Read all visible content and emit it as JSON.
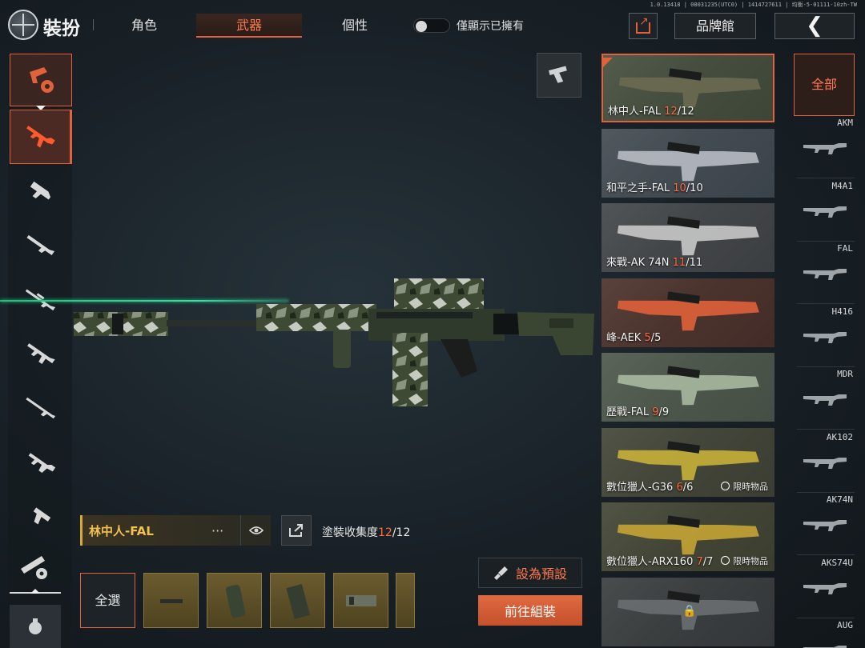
{
  "version_text": "1.0.13418 | 08031235(UTC0) | 1414727611 | 均衡-5-01111-10zh-TW",
  "header": {
    "title": "裝扮",
    "tabs": [
      {
        "label": "角色",
        "active": false
      },
      {
        "label": "武器",
        "active": true
      },
      {
        "label": "個性",
        "active": false
      }
    ],
    "owned_only_label": "僅顯示已擁有",
    "owned_only_on": false,
    "brand_button": "品牌館"
  },
  "left_categories": [
    {
      "icon": "skin-category-icon",
      "selected": false
    },
    {
      "icon": "assault-rifle-icon",
      "selected": true
    },
    {
      "icon": "smg-icon",
      "selected": false
    },
    {
      "icon": "shotgun-icon",
      "selected": false
    },
    {
      "icon": "sniper-rifle-icon",
      "selected": false
    },
    {
      "icon": "lmg-icon",
      "selected": false
    },
    {
      "icon": "marksman-rifle-icon",
      "selected": false
    },
    {
      "icon": "carbine-icon",
      "selected": false
    },
    {
      "icon": "pistol-icon",
      "selected": false
    },
    {
      "icon": "accessory-category-icon",
      "selected": false
    }
  ],
  "current_skin": {
    "name": "林中人-FAL",
    "more": "···",
    "collection_label": "塗裝收集度",
    "collected": "12",
    "total": "/12"
  },
  "parts_panel": {
    "select_all": "全選",
    "parts": [
      "muzzle-part",
      "grip-part",
      "magazine-part",
      "scope-part"
    ]
  },
  "actions": {
    "set_default": "設為預設",
    "go_assemble": "前往組裝"
  },
  "skins": [
    {
      "name": "林中人-FAL ",
      "owned": "12",
      "total": "/12",
      "limited": "",
      "locked": false,
      "selected": true,
      "colors": [
        "#4e5a3e",
        "#6c6a52"
      ]
    },
    {
      "name": "和平之手-FAL ",
      "owned": "10",
      "total": "/10",
      "limited": "",
      "locked": false,
      "selected": false,
      "colors": [
        "#4a5560",
        "#b8bcc4"
      ]
    },
    {
      "name": "來戰-AK 74N ",
      "owned": "11",
      "total": "/11",
      "limited": "",
      "locked": false,
      "selected": false,
      "colors": [
        "#4a4c50",
        "#c8c8c8"
      ]
    },
    {
      "name": "峰-AEK ",
      "owned": "5",
      "total": "/5",
      "limited": "",
      "locked": false,
      "selected": false,
      "colors": [
        "#5a2a20",
        "#e0603a"
      ]
    },
    {
      "name": "歷戰-FAL ",
      "owned": "9",
      "total": "/9",
      "limited": "",
      "locked": false,
      "selected": false,
      "colors": [
        "#5c6a56",
        "#a8b8a0"
      ]
    },
    {
      "name": "數位獵人-G36 ",
      "owned": "6",
      "total": "/6",
      "limited": "限時物品",
      "locked": false,
      "selected": false,
      "colors": [
        "#4a4a34",
        "#c8b038"
      ]
    },
    {
      "name": "數位獵人-ARX160 ",
      "owned": "7",
      "total": "/7",
      "limited": "限時物品",
      "locked": false,
      "selected": false,
      "colors": [
        "#4a4a30",
        "#c4a434"
      ]
    },
    {
      "name": "",
      "owned": "",
      "total": "",
      "limited": "",
      "locked": true,
      "selected": false,
      "colors": [
        "#3a3e40",
        "#6a6e70"
      ]
    }
  ],
  "weapon_filter": {
    "all_label": "全部",
    "weapons": [
      "AKM",
      "M4A1",
      "FAL",
      "H416",
      "MDR",
      "AK102",
      "AK74N",
      "AKS74U",
      "AUG"
    ]
  },
  "colors": {
    "accent": "#e0613b",
    "highlight": "#ff6a3d",
    "gold": "#f2c14e",
    "laser": "#2fe09a"
  }
}
